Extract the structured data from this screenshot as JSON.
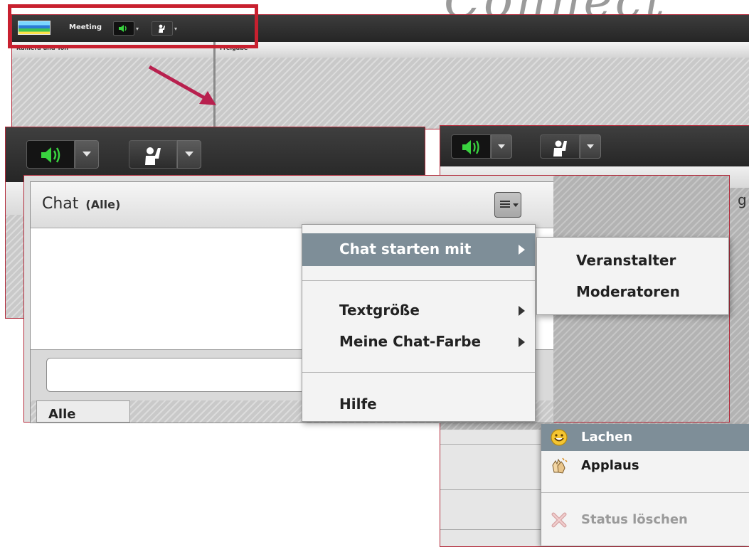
{
  "brand": {
    "title": "Connect"
  },
  "overview": {
    "meeting_label": "Meeting",
    "pane_left_title": "Kamera und Ton",
    "pane_right_title": "Freigabe"
  },
  "chat": {
    "title": "Chat",
    "scope": "(Alle)",
    "tab_all": "Alle",
    "input_value": ""
  },
  "context_menu": {
    "items": [
      {
        "label": "Chat starten mit",
        "has_submenu": true,
        "selected": true
      },
      {
        "label": "Textgröße",
        "has_submenu": true
      },
      {
        "label": "Meine Chat-Farbe",
        "has_submenu": true
      },
      {
        "label": "Hilfe",
        "has_submenu": false
      }
    ]
  },
  "submenu": {
    "items": [
      {
        "label": "Veranstalter"
      },
      {
        "label": "Moderatoren"
      }
    ]
  },
  "status_menu": {
    "items": [
      {
        "label": "Lachen",
        "icon": "smiley-icon",
        "selected": true
      },
      {
        "label": "Applaus",
        "icon": "applause-icon"
      },
      {
        "label": "Status löschen",
        "icon": "clear-status-icon",
        "disabled": true
      }
    ]
  },
  "right_pane": {
    "partial_label": "g"
  },
  "colors": {
    "highlight": "#c8202f",
    "menu_selected": "#7e8e98",
    "toolbar": "#2e2e2e",
    "speaker_green": "#39d33f"
  }
}
